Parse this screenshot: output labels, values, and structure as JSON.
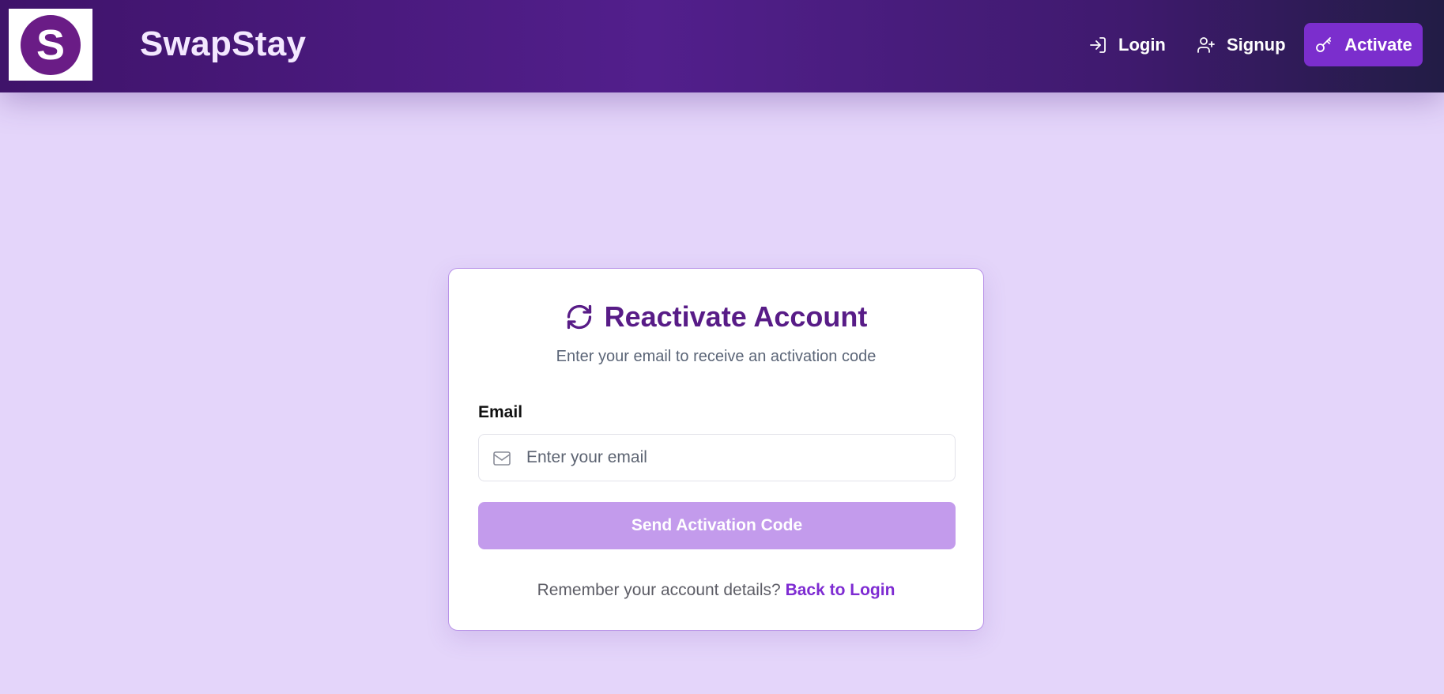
{
  "header": {
    "logo_letter": "S",
    "brand": "SwapStay",
    "nav": {
      "login": "Login",
      "signup": "Signup",
      "activate": "Activate"
    }
  },
  "card": {
    "title": "Reactivate Account",
    "subtitle": "Enter your email to receive an activation code",
    "email_label": "Email",
    "email_placeholder": "Enter your email",
    "email_value": "",
    "submit_label": "Send Activation Code",
    "footer_text": "Remember your account details?",
    "footer_link": "Back to Login"
  },
  "icons": {
    "login": "login-icon",
    "signup": "user-plus-icon",
    "activate": "key-icon",
    "title": "refresh-icon",
    "email": "mail-icon"
  },
  "colors": {
    "primary": "#581c87",
    "accent": "#7b2ecd",
    "button_disabled": "#c39bec",
    "page_bg": "#e4d5fa"
  }
}
